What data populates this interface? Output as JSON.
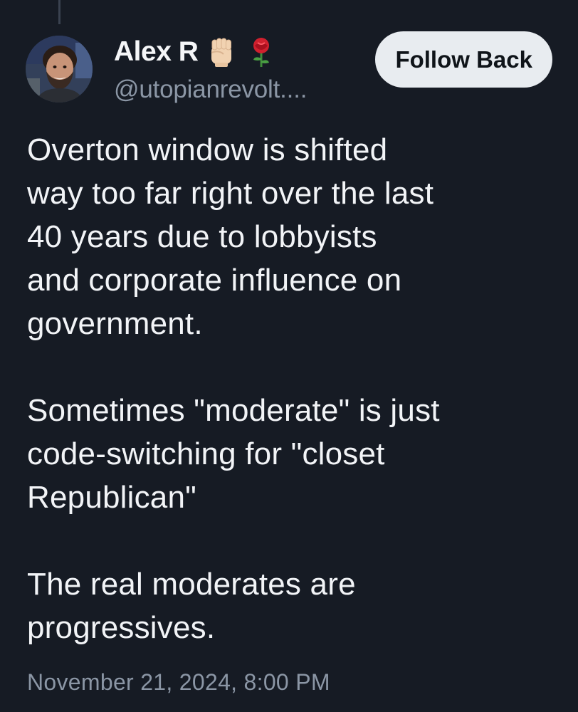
{
  "author": {
    "display_name": "Alex R",
    "handle": "@utopianrevolt....",
    "name_emojis": [
      "raised-fist-icon",
      "rose-icon"
    ]
  },
  "actions": {
    "follow_label": "Follow Back"
  },
  "post": {
    "paragraphs": [
      [
        "Overton window is shifted",
        "way too far right over the last",
        "40 years due to lobbyists",
        "and corporate influence on",
        "government."
      ],
      [
        "Sometimes \"moderate\" is just",
        "code-switching for \"closet",
        "Republican\""
      ],
      [
        "The real moderates are",
        "progressives."
      ]
    ],
    "timestamp": "November 21, 2024, 8:00 PM"
  },
  "colors": {
    "background": "#161b24",
    "text": "#f2f4f7",
    "secondary_text": "#8b96a5",
    "button_bg": "#e8ecf0",
    "button_text": "#0f1419"
  }
}
